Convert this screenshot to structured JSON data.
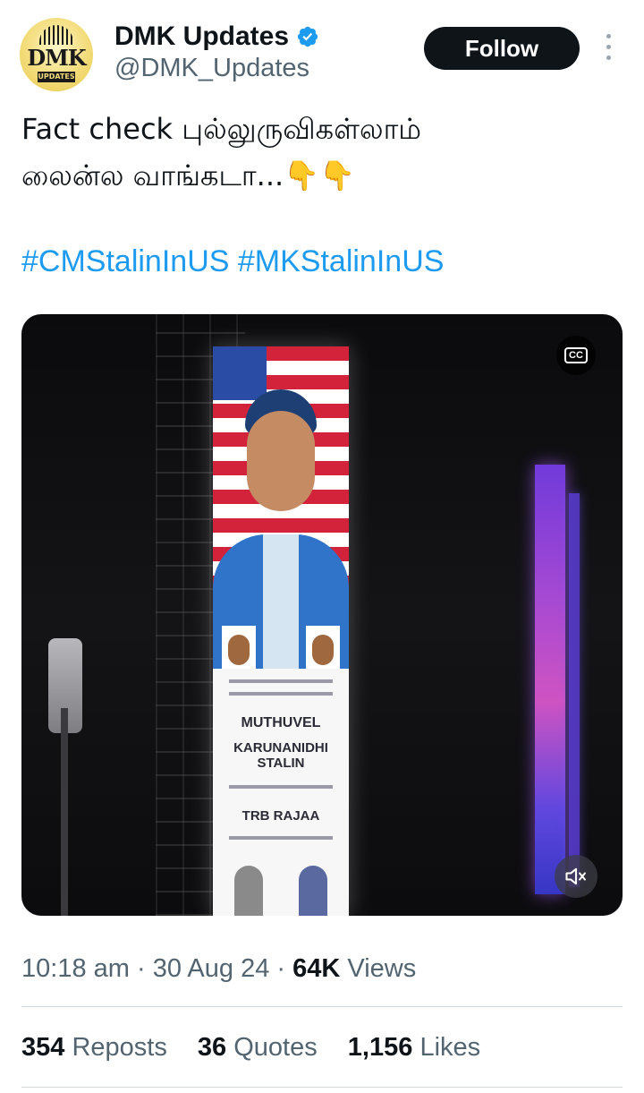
{
  "author": {
    "display_name": "DMK Updates",
    "handle": "@DMK_Updates",
    "logo_text": "DMK",
    "logo_subtext": "UPDATES",
    "verified": true,
    "verified_color": "#1d9bf0"
  },
  "follow_button": {
    "label": "Follow"
  },
  "tweet": {
    "lines": [
      "Fact check புல்லுருவிகள்லாம்",
      "லைன்ல வாங்கடா...👇👇"
    ],
    "hashtags": [
      "#CMStalinInUS",
      "#MKStalinInUS"
    ],
    "hashtag_color": "#1d9bf0"
  },
  "media": {
    "cc_label": "CC",
    "billboard_text": {
      "line1": "MUTHUVEL",
      "line2": "KARUNANIDHI STALIN",
      "line3": "TRB RAJAA"
    }
  },
  "meta": {
    "time": "10:18 am",
    "date": "30 Aug 24",
    "views_count": "64K",
    "views_label": "Views"
  },
  "stats": [
    {
      "count": "354",
      "label": "Reposts"
    },
    {
      "count": "36",
      "label": "Quotes"
    },
    {
      "count": "1,156",
      "label": "Likes"
    }
  ],
  "colors": {
    "text": "#0f1419",
    "secondary": "#536471",
    "divider": "#cfd9de"
  }
}
